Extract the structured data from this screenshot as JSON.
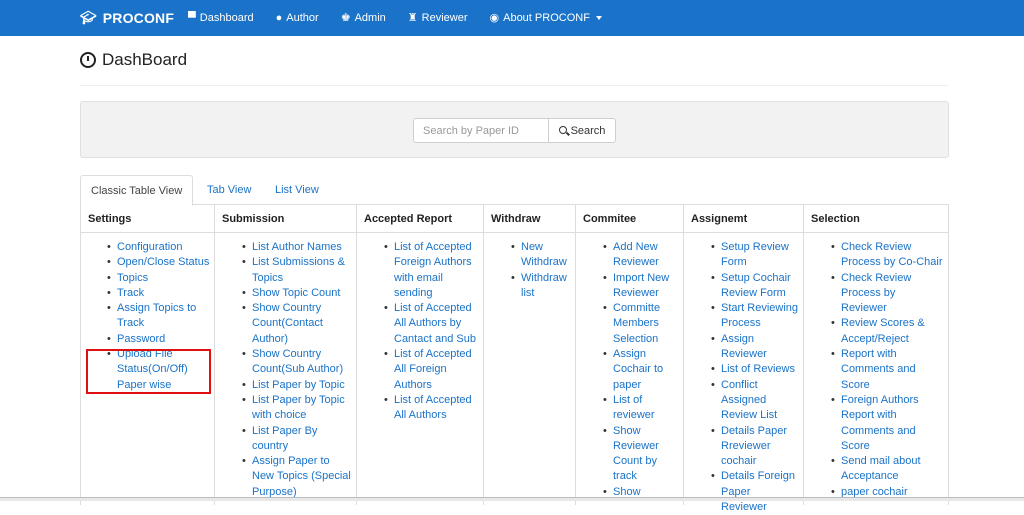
{
  "navbar": {
    "brand": "PROCONF",
    "items": [
      {
        "label": "Dashboard",
        "icon": "dashboard-icon",
        "glyph": "▀"
      },
      {
        "label": "Author",
        "icon": "user-icon",
        "glyph": "●"
      },
      {
        "label": "Admin",
        "icon": "admin-icon",
        "glyph": "♚"
      },
      {
        "label": "Reviewer",
        "icon": "reviewer-icon",
        "glyph": "♜"
      },
      {
        "label": "About PROCONF",
        "icon": "eye-icon",
        "glyph": "◉"
      }
    ],
    "brand_color": "#1a73c8"
  },
  "page": {
    "title": "DashBoard"
  },
  "search": {
    "placeholder": "Search by Paper ID",
    "button_label": "Search"
  },
  "tabs": [
    {
      "label": "Classic Table View",
      "active": true
    },
    {
      "label": "Tab View",
      "active": false
    },
    {
      "label": "List View",
      "active": false
    }
  ],
  "table": {
    "columns": [
      {
        "header": "Settings",
        "items": [
          "Configuration",
          "Open/Close Status",
          "Topics",
          "Track",
          "Assign Topics to Track",
          "Password",
          "Upload File Status(On/Off) Paper wise"
        ]
      },
      {
        "header": "Submission",
        "items": [
          "List Author Names",
          "List Submissions & Topics",
          "Show Topic Count",
          "Show Country Count(Contact Author)",
          "Show Country Count(Sub Author)",
          "List Paper by Topic",
          "List Paper by Topic with choice",
          "List Paper By country",
          "Assign Paper to New Topics (Special Purpose)"
        ]
      },
      {
        "header": "Accepted Report",
        "items": [
          "List of Accepted Foreign Authors with email sending",
          "List of Accepted All Authors by Cantact and Sub",
          "List of Accepted All Foreign Authors",
          "List of Accepted All Authors"
        ]
      },
      {
        "header": "Withdraw",
        "items": [
          "New Withdraw",
          "Withdraw list"
        ]
      },
      {
        "header": "Commitee",
        "items": [
          "Add New Reviewer",
          "Import New Reviewer",
          "Committe Members Selection",
          "Assign Cochair to paper",
          "List of reviewer",
          "Show Reviewer Count by track",
          "Show"
        ]
      },
      {
        "header": "Assignemt",
        "items": [
          "Setup Review Form",
          "Setup Cochair Review Form",
          "Start Reviewing Process",
          "Assign Reviewer",
          "List of Reviews",
          "Conflict Assigned Review List",
          "Details Paper Rreviewer cochair",
          "Details Foreign Paper Reviewer"
        ]
      },
      {
        "header": "Selection",
        "items": [
          "Check Review Process by Co-Chair",
          "Check Review Process by Reviewer",
          "Review Scores & Accept/Reject",
          "Report with Comments and Score",
          "Foreign Authors Report with Comments and Score",
          "Send mail about Acceptance",
          "paper cochair"
        ]
      }
    ]
  }
}
